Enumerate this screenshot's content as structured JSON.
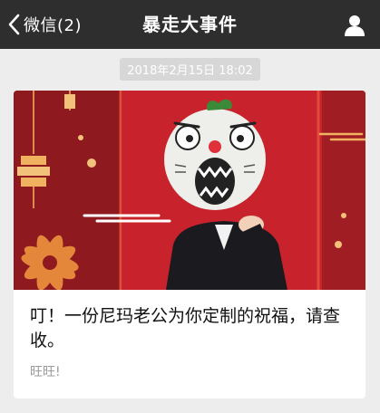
{
  "navbar": {
    "back_label": "微信(2)",
    "title": "暴走大事件",
    "back_icon": "chevron-left-icon",
    "profile_icon": "person-icon"
  },
  "timestamp": "2018年2月15日 18:02",
  "article": {
    "title": "叮！一份尼玛老公为你定制的祝福，请查收。",
    "digest": "旺旺!"
  },
  "colors": {
    "navbar": "#2e2e2e",
    "background": "#ededed",
    "cover_red": "#c8232c",
    "cover_dark_red": "#8e1a1f"
  }
}
